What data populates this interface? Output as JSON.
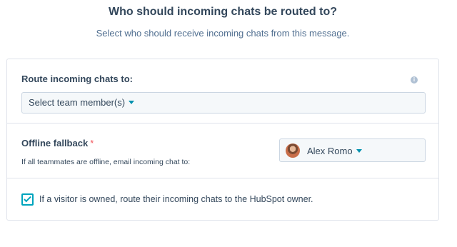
{
  "header": {
    "title": "Who should incoming chats be routed to?",
    "subtitle": "Select who should receive incoming chats from this message."
  },
  "routing": {
    "label": "Route incoming chats to:",
    "info_icon": "info-icon",
    "select_placeholder": "Select team member(s)"
  },
  "offline_fallback": {
    "label": "Offline fallback",
    "required_marker": "*",
    "help_text": "If all teammates are offline, email incoming chat to:",
    "selected_owner": "Alex Romo"
  },
  "owner_routing": {
    "checked": true,
    "label": "If a visitor is owned, route their incoming chats to the HubSpot owner."
  },
  "colors": {
    "accent": "#00a4bd",
    "caret": "#0091ae",
    "required": "#f2545b",
    "text": "#33475b",
    "border": "#dfe3eb"
  }
}
